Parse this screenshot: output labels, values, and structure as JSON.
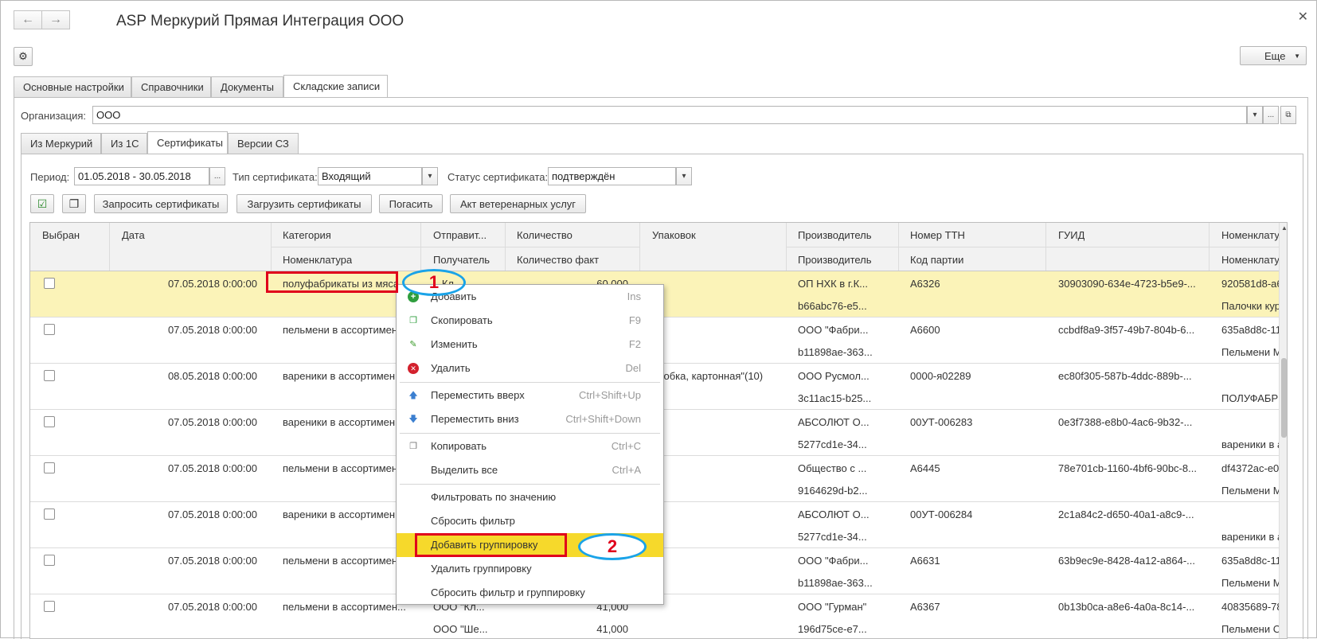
{
  "window": {
    "title": "ASP Меркурий Прямая Интеграция ООО",
    "more_label": "Еще"
  },
  "main_tabs": [
    {
      "label": "Основные настройки"
    },
    {
      "label": "Справочники"
    },
    {
      "label": "Документы"
    },
    {
      "label": "Складские записи"
    }
  ],
  "org": {
    "label": "Организация:",
    "value": "ООО"
  },
  "sub_tabs": [
    {
      "label": "Из Меркурий"
    },
    {
      "label": "Из 1С"
    },
    {
      "label": "Сертификаты"
    },
    {
      "label": "Версии СЗ"
    }
  ],
  "filters": {
    "period_label": "Период:",
    "period_value": "01.05.2018 - 30.05.2018",
    "cert_type_label": "Тип сертификата:",
    "cert_type_value": "Входящий",
    "cert_status_label": "Статус сертификата:",
    "cert_status_value": "подтверждён"
  },
  "toolbar": {
    "request": "Запросить сертификаты",
    "load": "Загрузить сертификаты",
    "redeem": "Погасить",
    "vet_act": "Акт ветеренарных услуг"
  },
  "columns": {
    "selected": "Выбран",
    "date": "Дата",
    "category": "Категория",
    "nomenclature": "Номенклатура",
    "sender": "Отправит...",
    "receiver": "Получатель",
    "qty": "Количество",
    "qty_fact": "Количество факт",
    "packages": "Упаковок",
    "producer": "Производитель",
    "producer2": "Производитель",
    "ttn": "Номер ТТН",
    "batch": "Код партии",
    "guid": "ГУИД",
    "nomen_right": "Номенклату",
    "nomen_right2": "Номенклату"
  },
  "rows": [
    {
      "date": "07.05.2018 0:00:00",
      "category": "полуфабрикаты из мяса",
      "sender": "...Кл...",
      "qty": "60,000",
      "packages": "",
      "producer": "ОП НХК в г.К...",
      "producer2": "b66abc76-e5...",
      "ttn": "A6326",
      "guid": "30903090-634e-4723-b5e9-...",
      "nr1": "920581d8-a6",
      "nr2": "Палочки кур"
    },
    {
      "date": "07.05.2018 0:00:00",
      "category": "пельмени в ассортимен",
      "producer": "ООО \"Фабри...",
      "producer2": "b11898ae-363...",
      "ttn": "A6600",
      "guid": "ccbdf8a9-3f57-49b7-804b-6...",
      "nr1": "635a8d8c-11",
      "nr2": "Пельмени М"
    },
    {
      "date": "08.05.2018 0:00:00",
      "category": "вареники в ассортимен",
      "packages": "оробка, картонная\"(10)",
      "producer": "ООО Русмол...",
      "producer2": "3c11ac15-b25...",
      "ttn": "0000-я02289",
      "guid": "ec80f305-587b-4ddc-889b-...",
      "nr1": "",
      "nr2": "ПОЛУФАБР"
    },
    {
      "date": "07.05.2018 0:00:00",
      "category": "вареники в ассортимен",
      "producer": "АБСОЛЮТ О...",
      "producer2": "5277cd1e-34...",
      "ttn": "00УТ-006283",
      "guid": "0e3f7388-e8b0-4ac6-9b32-...",
      "nr1": "",
      "nr2": "вареники в а"
    },
    {
      "date": "07.05.2018 0:00:00",
      "category": "пельмени в ассортимен",
      "producer": "Общество с ...",
      "producer2": "9164629d-b2...",
      "ttn": "A6445",
      "guid": "78e701cb-1160-4bf6-90bc-8...",
      "nr1": "df4372ac-e0",
      "nr2": "Пельмени М"
    },
    {
      "date": "07.05.2018 0:00:00",
      "category": "вареники в ассортимен",
      "producer": "АБСОЛЮТ О...",
      "producer2": "5277cd1e-34...",
      "ttn": "00УТ-006284",
      "guid": "2c1a84c2-d650-40a1-a8c9-...",
      "nr1": "",
      "nr2": "вареники в а"
    },
    {
      "date": "07.05.2018 0:00:00",
      "category": "пельмени в ассортимен",
      "producer": "ООО \"Фабри...",
      "producer2": "b11898ae-363...",
      "ttn": "A6631",
      "guid": "63b9ec9e-8428-4a12-a864-...",
      "nr1": "635a8d8c-11",
      "nr2": "Пельмени М"
    },
    {
      "date": "07.05.2018 0:00:00",
      "category": "пельмени в ассортимен...",
      "sender": "ООО \"Кл...",
      "receiver": "ООО \"Ше...",
      "qty": "41,000",
      "qty_fact": "41,000",
      "producer": "ООО \"Гурман\"",
      "producer2": "196d75ce-e7...",
      "ttn": "A6367",
      "guid": "0b13b0ca-a8e6-4a0a-8c14-...",
      "nr1": "40835689-78",
      "nr2": "Пельмени С"
    }
  ],
  "context_menu": [
    {
      "label": "Добавить",
      "shortcut": "Ins",
      "icon": "add-icon"
    },
    {
      "label": "Скопировать",
      "shortcut": "F9",
      "icon": "copy-icon"
    },
    {
      "label": "Изменить",
      "shortcut": "F2",
      "icon": "pencil-icon"
    },
    {
      "label": "Удалить",
      "shortcut": "Del",
      "icon": "delete-icon"
    },
    {
      "label": "Переместить вверх",
      "shortcut": "Ctrl+Shift+Up",
      "icon": "arrow-up-icon"
    },
    {
      "label": "Переместить вниз",
      "shortcut": "Ctrl+Shift+Down",
      "icon": "arrow-down-icon"
    },
    {
      "label": "Копировать",
      "shortcut": "Ctrl+C",
      "icon": "clipboard-icon"
    },
    {
      "label": "Выделить все",
      "shortcut": "Ctrl+A"
    },
    {
      "label": "Фильтровать по значению"
    },
    {
      "label": "Сбросить фильтр"
    },
    {
      "label": "Добавить группировку"
    },
    {
      "label": "Удалить группировку"
    },
    {
      "label": "Сбросить фильтр и группировку"
    }
  ],
  "annotations": {
    "one": "1",
    "two": "2"
  },
  "colors": {
    "highlight_row": "#fbf3b8",
    "menu_highlight": "#f6d92b",
    "annotation_red": "#e0001b",
    "annotation_blue": "#1aa3e8"
  }
}
